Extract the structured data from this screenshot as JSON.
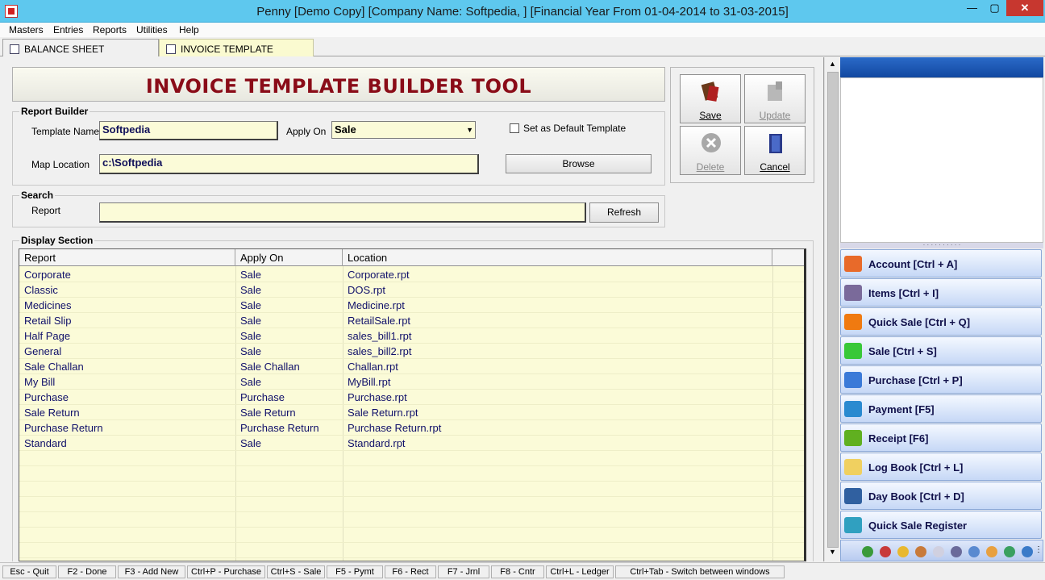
{
  "window": {
    "title": "Penny [Demo Copy] [Company Name: Softpedia, ] [Financial Year From 01-04-2014 to 31-03-2015]",
    "minimize": "—",
    "maximize": "▢",
    "close": "✕"
  },
  "menu": [
    "Masters",
    "Entries",
    "Reports",
    "Utilities",
    "Help"
  ],
  "tabs": [
    "BALANCE SHEET",
    "INVOICE TEMPLATE"
  ],
  "header": {
    "title": "INVOICE TEMPLATE BUILDER TOOL"
  },
  "report_builder": {
    "legend": "Report Builder",
    "template_name_label": "Template Name",
    "template_name_value": "Softpedia",
    "apply_on_label": "Apply On",
    "apply_on_value": "Sale",
    "default_label": "Set as Default Template",
    "map_location_label": "Map Location",
    "map_location_value": "c:\\Softpedia",
    "browse": "Browse"
  },
  "actions": {
    "save": "Save",
    "update": "Update",
    "delete": "Delete",
    "cancel": "Cancel"
  },
  "search": {
    "legend": "Search",
    "report_label": "Report",
    "report_value": "",
    "refresh": "Refresh"
  },
  "display": {
    "legend": "Display Section",
    "columns": [
      "Report",
      "Apply On",
      "Location"
    ],
    "rows": [
      [
        "Corporate",
        "Sale",
        "Corporate.rpt"
      ],
      [
        "Classic",
        "Sale",
        "DOS.rpt"
      ],
      [
        "Medicines",
        "Sale",
        "Medicine.rpt"
      ],
      [
        "Retail Slip",
        "Sale",
        "RetailSale.rpt"
      ],
      [
        "Half Page",
        "Sale",
        "sales_bill1.rpt"
      ],
      [
        "General",
        "Sale",
        "sales_bill2.rpt"
      ],
      [
        "Sale Challan",
        "Sale Challan",
        "Challan.rpt"
      ],
      [
        "My Bill",
        "Sale",
        "MyBill.rpt"
      ],
      [
        "Purchase",
        "Purchase",
        "Purchase.rpt"
      ],
      [
        "Sale Return",
        "Sale Return",
        "Sale Return.rpt"
      ],
      [
        "Purchase Return",
        "Purchase Return",
        "Purchase Return.rpt"
      ],
      [
        "Standard",
        "Sale",
        "Standard.rpt"
      ]
    ]
  },
  "sidebar": {
    "items": [
      {
        "label": "Account [Ctrl + A]",
        "icon": "account-icon",
        "color": "#e86a2a"
      },
      {
        "label": "Items [Ctrl + I]",
        "icon": "items-icon",
        "color": "#7a6a9a"
      },
      {
        "label": "Quick Sale [Ctrl + Q]",
        "icon": "quick-sale-icon",
        "color": "#f07a10"
      },
      {
        "label": "Sale [Ctrl + S]",
        "icon": "sale-icon",
        "color": "#38c838"
      },
      {
        "label": "Purchase [Ctrl + P]",
        "icon": "purchase-icon",
        "color": "#3a7ad8"
      },
      {
        "label": "Payment [F5]",
        "icon": "payment-icon",
        "color": "#2a8ad0"
      },
      {
        "label": "Receipt [F6]",
        "icon": "receipt-icon",
        "color": "#60b020"
      },
      {
        "label": "Log Book [Ctrl + L]",
        "icon": "log-book-icon",
        "color": "#f0d060"
      },
      {
        "label": "Day Book [Ctrl + D]",
        "icon": "day-book-icon",
        "color": "#3060a0"
      },
      {
        "label": "Quick Sale Register",
        "icon": "quick-sale-register-icon",
        "color": "#30a0c0"
      }
    ]
  },
  "statusbar": [
    "Esc - Quit",
    "F2 - Done",
    "F3 - Add New",
    "Ctrl+P - Purchase",
    "Ctrl+S - Sale",
    "F5 - Pymt",
    "F6 - Rect",
    "F7 - Jrnl",
    "F8 - Cntr",
    "Ctrl+L - Ledger",
    "Ctrl+Tab - Switch between windows"
  ]
}
